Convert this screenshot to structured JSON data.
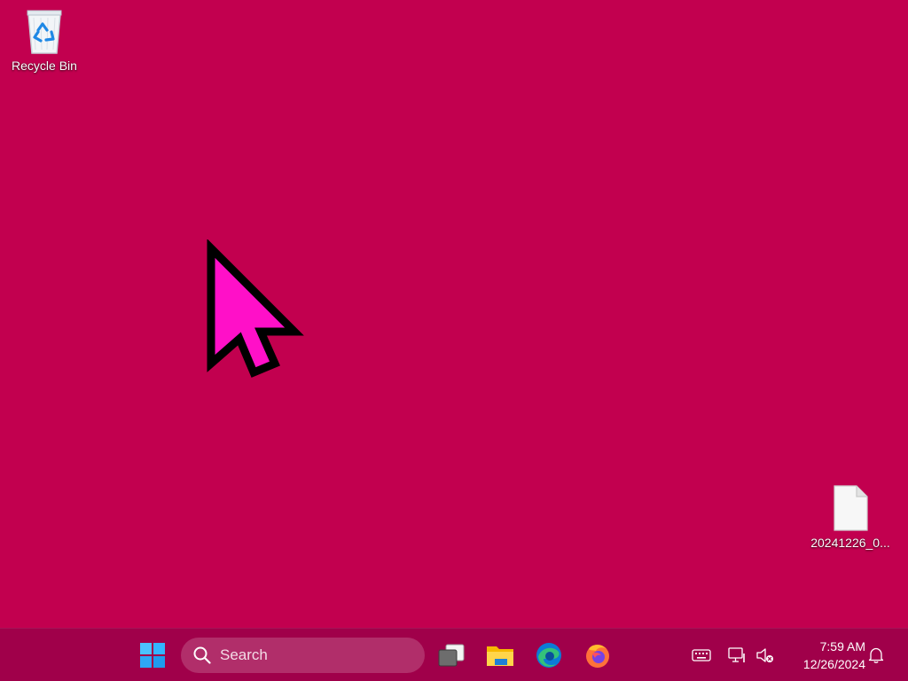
{
  "desktop": {
    "background": "#c2004f",
    "icons": [
      {
        "label": "Recycle Bin",
        "icon": "recycle-bin-icon"
      },
      {
        "label": "20241226_0...",
        "icon": "file-icon"
      }
    ]
  },
  "taskbar": {
    "background": "#a0004a",
    "start_icon": "windows-logo-icon",
    "search": {
      "placeholder": "Search"
    },
    "apps": [
      {
        "name": "Task View",
        "icon": "task-view-icon"
      },
      {
        "name": "File Explorer",
        "icon": "folder-icon"
      },
      {
        "name": "Microsoft Edge",
        "icon": "edge-icon"
      },
      {
        "name": "Firefox",
        "icon": "firefox-icon"
      }
    ],
    "tray": {
      "icons": [
        "keyboard-icon",
        "network-icon",
        "volume-muted-icon",
        "bell-icon"
      ],
      "time": "7:59 AM",
      "date": "12/26/2024"
    }
  },
  "cursor": {
    "color": "#ff10c8"
  }
}
